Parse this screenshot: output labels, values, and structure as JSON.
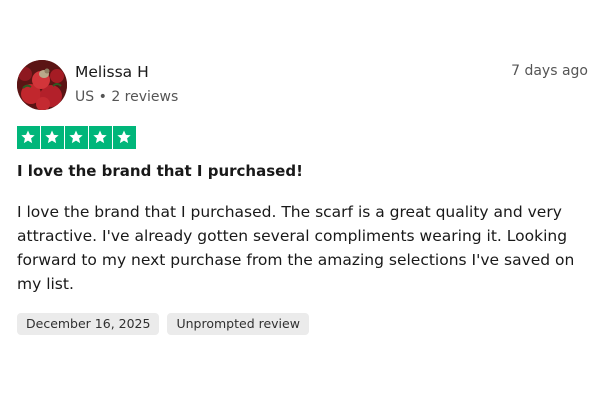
{
  "reviewer": {
    "name": "Melissa H",
    "country": "US",
    "separator": "•",
    "review_count": "2 reviews"
  },
  "relative_date": "7 days ago",
  "rating": {
    "stars": 5,
    "max": 5,
    "color": "#00b67a"
  },
  "review": {
    "title": "I love the brand that I purchased!",
    "body": "I love the brand that I purchased. The scarf is a great quality and very attractive. I've already gotten several compliments wearing it. Looking forward to my next purchase from the amazing selections I've saved on my list."
  },
  "tags": {
    "date": "December 16, 2025",
    "label": "Unprompted review"
  },
  "icons": {
    "avatar": "roses-bird-photo",
    "star": "star-icon"
  }
}
